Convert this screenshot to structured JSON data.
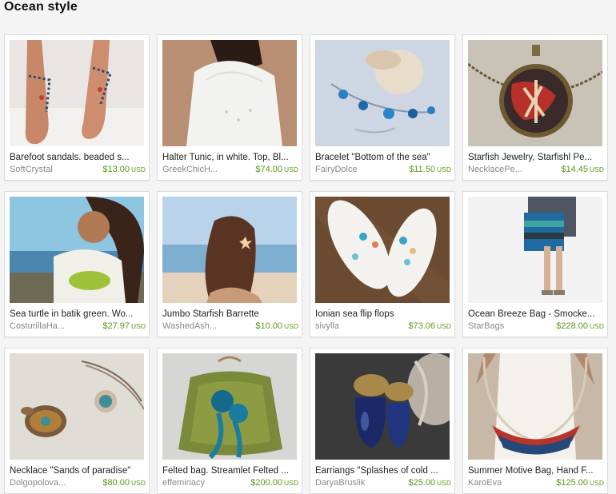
{
  "page": {
    "title": "Ocean style"
  },
  "colors": {
    "price": "#5a9a1c",
    "shop": "#888888",
    "card_bg": "#ffffff",
    "page_bg": "#f4f4f4"
  },
  "items": [
    {
      "name": "Barefoot sandals. beaded s...",
      "shop": "SoftCrystal",
      "price": "$13.00",
      "currency": "USD",
      "image": "barefoot-sandals-image"
    },
    {
      "name": "Halter Tunic, in white. Top, Bl...",
      "shop": "GreekChicH...",
      "price": "$74.00",
      "currency": "USD",
      "image": "white-halter-tunic-image"
    },
    {
      "name": "Bracelet \"Bottom of the sea\"",
      "shop": "FairyDolce",
      "price": "$11.50",
      "currency": "USD",
      "image": "shell-bracelet-image"
    },
    {
      "name": "Starfish Jewelry, Starfishl Pe...",
      "shop": "NecklacePe...",
      "price": "$14.45",
      "currency": "USD",
      "image": "starfish-pendant-image"
    },
    {
      "name": "Sea turtle in batik green. Wo...",
      "shop": "CosturillaHa...",
      "price": "$27.97",
      "currency": "USD",
      "image": "turtle-shirt-image"
    },
    {
      "name": "Jumbo Starfish Barrette",
      "shop": "WashedAsh...",
      "price": "$10.00",
      "currency": "USD",
      "image": "starfish-barrette-image"
    },
    {
      "name": "Ionian sea flip flops",
      "shop": "sivylla",
      "price": "$73.06",
      "currency": "USD",
      "image": "flip-flops-image"
    },
    {
      "name": "Ocean Breeze Bag - Smocke...",
      "shop": "StarBags",
      "price": "$228.00",
      "currency": "USD",
      "image": "striped-bag-image"
    },
    {
      "name": "Necklace \"Sands of paradise\"",
      "shop": "Dolgopolova...",
      "price": "$80.00",
      "currency": "USD",
      "image": "turtle-necklace-image"
    },
    {
      "name": "Felted bag. Streamlet Felted ...",
      "shop": "effeminacy",
      "price": "$200.00",
      "currency": "USD",
      "image": "felted-bag-image"
    },
    {
      "name": "Earriangs \"Splashes of cold ...",
      "shop": "DaryaBruslik",
      "price": "$25.00",
      "currency": "USD",
      "image": "blue-earrings-image"
    },
    {
      "name": "Summer Motive Bag, Hand F...",
      "shop": "KaroEva",
      "price": "$125.00",
      "currency": "USD",
      "image": "summer-bag-image"
    }
  ]
}
